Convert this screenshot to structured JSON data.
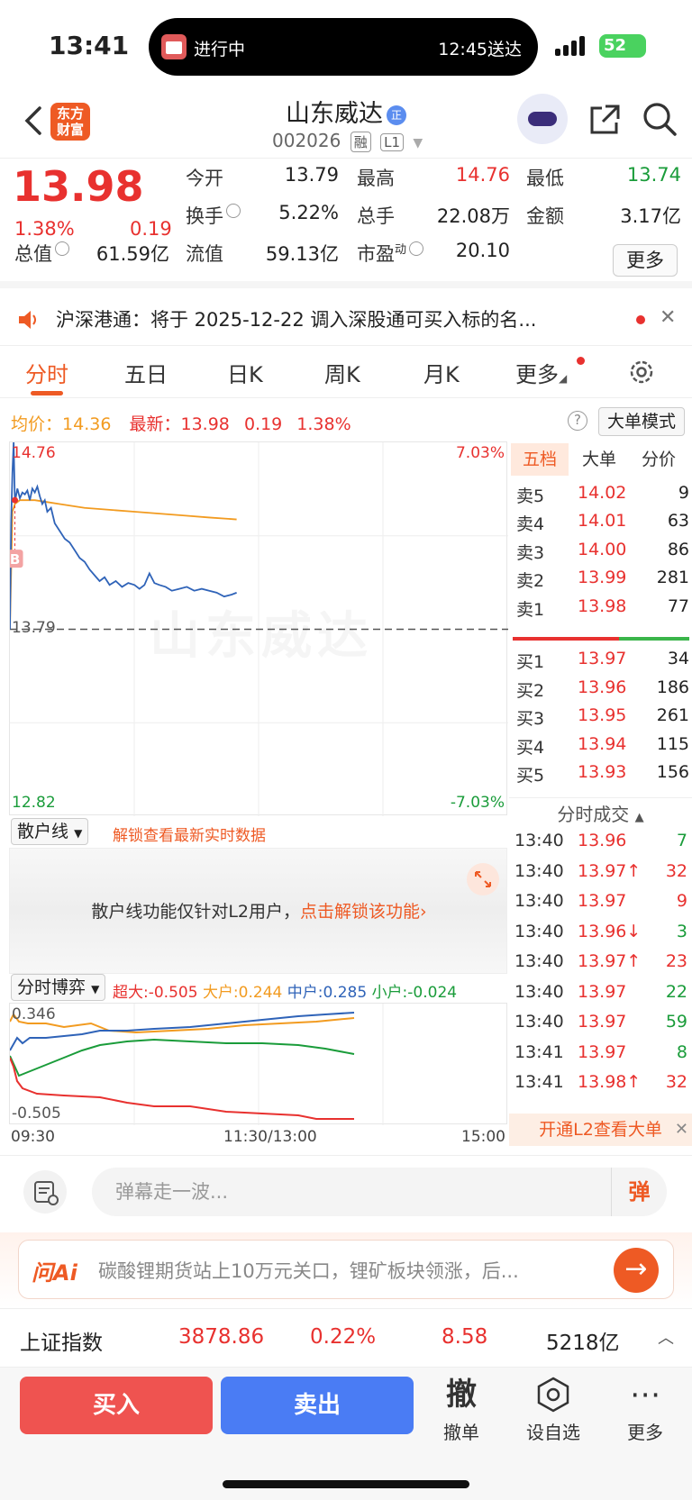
{
  "status_bar": {
    "time": "13:41",
    "activity_left": "进行中",
    "activity_right": "12:45送达",
    "battery": "52"
  },
  "header": {
    "logo_line1": "东方",
    "logo_line2": "财富",
    "stock_name": "山东威达",
    "name_badge": "正",
    "stock_code": "002026",
    "tag1": "融",
    "tag2": "L1"
  },
  "quote": {
    "price": "13.98",
    "change_pct": "1.38%",
    "change": "0.19",
    "fields": [
      {
        "label": "今开",
        "value": "13.79",
        "color": "#222222"
      },
      {
        "label": "最高",
        "value": "14.76",
        "color": "#e8312f"
      },
      {
        "label": "最低",
        "value": "13.74",
        "color": "#1a9c3a"
      },
      {
        "label": "换手",
        "value": "5.22%",
        "color": "#222222"
      },
      {
        "label": "总手",
        "value": "22.08万",
        "color": "#222222"
      },
      {
        "label": "金额",
        "value": "3.17亿",
        "color": "#222222"
      },
      {
        "label": "总值",
        "value": "61.59亿",
        "color": "#222222"
      },
      {
        "label": "流值",
        "value": "59.13亿",
        "color": "#222222"
      },
      {
        "label": "市盈",
        "label_sup": "动",
        "value": "20.10",
        "color": "#222222"
      }
    ],
    "more_label": "更多"
  },
  "notice": {
    "text": "沪深港通：将于 2025-12-22 调入深股通可买入标的名..."
  },
  "tabs": [
    "分时",
    "五日",
    "日K",
    "周K",
    "月K",
    "更多"
  ],
  "info_line": {
    "avg_label": "均价：",
    "avg_value": "14.36",
    "last_label": "最新：",
    "last_value": "13.98",
    "change": "0.19",
    "change_pct": "1.38%",
    "big_order_mode": "大单模式"
  },
  "chart_data": {
    "type": "line",
    "title": "",
    "y_axis_left": {
      "top": "14.76",
      "mid": "13.79",
      "bottom": "12.82"
    },
    "y_axis_right": {
      "top": "7.03%",
      "bottom": "-7.03%"
    },
    "ylim": [
      12.82,
      14.76
    ],
    "prev_close": 13.79,
    "marker": "B",
    "series": [
      {
        "color": "#2f63b8",
        "x": [
          0,
          1,
          2,
          3,
          4,
          6,
          8,
          10,
          12,
          14,
          16,
          18,
          20,
          22,
          24,
          26,
          28,
          30,
          33,
          36,
          40,
          44,
          48,
          52,
          56,
          60,
          64,
          68,
          72,
          76,
          80,
          85,
          90,
          95,
          100,
          104,
          108,
          112,
          116,
          120,
          125,
          130,
          136,
          142,
          148,
          154,
          160,
          166,
          172,
          178,
          182
        ],
        "values": [
          13.79,
          14.35,
          14.6,
          14.76,
          14.45,
          14.52,
          14.47,
          14.5,
          14.49,
          14.51,
          14.46,
          14.52,
          14.5,
          14.53,
          14.48,
          14.44,
          14.46,
          14.4,
          14.42,
          14.34,
          14.3,
          14.26,
          14.24,
          14.2,
          14.16,
          14.14,
          14.1,
          14.07,
          14.04,
          14.06,
          14.02,
          14.04,
          14.01,
          14.03,
          14.02,
          14.0,
          14.02,
          14.08,
          14.03,
          14.02,
          14.01,
          13.99,
          14.0,
          14.01,
          13.99,
          14.0,
          13.99,
          13.98,
          13.96,
          13.97,
          13.98
        ]
      },
      {
        "color": "#f29b20",
        "x": [
          0,
          2,
          4,
          8,
          12,
          20,
          30,
          40,
          60,
          80,
          100,
          120,
          140,
          160,
          182
        ],
        "values": [
          13.79,
          14.4,
          14.44,
          14.46,
          14.46,
          14.46,
          14.45,
          14.44,
          14.42,
          14.41,
          14.4,
          14.39,
          14.38,
          14.37,
          14.36
        ]
      }
    ],
    "x_axis": [
      "09:30",
      "11:30/13:00",
      "15:00"
    ]
  },
  "order_book": {
    "tabs": [
      "五档",
      "大单",
      "分价"
    ],
    "asks": [
      {
        "label": "卖5",
        "price": "14.02",
        "vol": "9"
      },
      {
        "label": "卖4",
        "price": "14.01",
        "vol": "63"
      },
      {
        "label": "卖3",
        "price": "14.00",
        "vol": "86"
      },
      {
        "label": "卖2",
        "price": "13.99",
        "vol": "281"
      },
      {
        "label": "卖1",
        "price": "13.98",
        "vol": "77"
      }
    ],
    "bids": [
      {
        "label": "买1",
        "price": "13.97",
        "vol": "34"
      },
      {
        "label": "买2",
        "price": "13.96",
        "vol": "186"
      },
      {
        "label": "买3",
        "price": "13.95",
        "vol": "261"
      },
      {
        "label": "买4",
        "price": "13.94",
        "vol": "115"
      },
      {
        "label": "买5",
        "price": "13.93",
        "vol": "156"
      }
    ]
  },
  "ticks": {
    "title": "分时成交",
    "rows": [
      {
        "time": "13:40",
        "price": "13.96",
        "vol": "7",
        "color": "#1a9c3a"
      },
      {
        "time": "13:40",
        "price": "13.97↑",
        "vol": "32",
        "color": "#e8312f"
      },
      {
        "time": "13:40",
        "price": "13.97",
        "vol": "9",
        "color": "#e8312f"
      },
      {
        "time": "13:40",
        "price": "13.96↓",
        "vol": "3",
        "color": "#1a9c3a"
      },
      {
        "time": "13:40",
        "price": "13.97↑",
        "vol": "23",
        "color": "#e8312f"
      },
      {
        "time": "13:40",
        "price": "13.97",
        "vol": "22",
        "color": "#1a9c3a"
      },
      {
        "time": "13:40",
        "price": "13.97",
        "vol": "59",
        "color": "#1a9c3a"
      },
      {
        "time": "13:41",
        "price": "13.97",
        "vol": "8",
        "color": "#1a9c3a"
      },
      {
        "time": "13:41",
        "price": "13.98↑",
        "vol": "32",
        "color": "#e8312f"
      }
    ],
    "l2_banner": "开通L2查看大单"
  },
  "retail_panel": {
    "dropdown": "散户线",
    "unlock_hint": "解锁查看最新实时数据",
    "msg": "散户线功能仅针对L2用户，",
    "msg_link": "点击解锁该功能"
  },
  "game_panel": {
    "dropdown": "分时博弈",
    "legend": [
      {
        "label": "超大:-0.505",
        "color": "#e8312f"
      },
      {
        "label": "大户:0.244",
        "color": "#f29b20"
      },
      {
        "label": "中户:0.285",
        "color": "#2f63b8"
      },
      {
        "label": "小户:-0.024",
        "color": "#1a9c3a"
      }
    ],
    "y_top": "0.346",
    "y_bottom": "-0.505"
  },
  "barrage": {
    "placeholder": "弹幕走一波...",
    "button": "弹"
  },
  "ai": {
    "logo": "问Ai",
    "text": "碳酸锂期货站上10万元关口，锂矿板块领涨，后..."
  },
  "index_bar": {
    "name": "上证指数",
    "value": "3878.86",
    "pct": "0.22%",
    "change": "8.58",
    "amount": "5218亿"
  },
  "bottom": {
    "buy": "买入",
    "sell": "卖出",
    "cancel_icon": "撤",
    "cancel": "撤单",
    "watch": "设自选",
    "more": "更多"
  }
}
